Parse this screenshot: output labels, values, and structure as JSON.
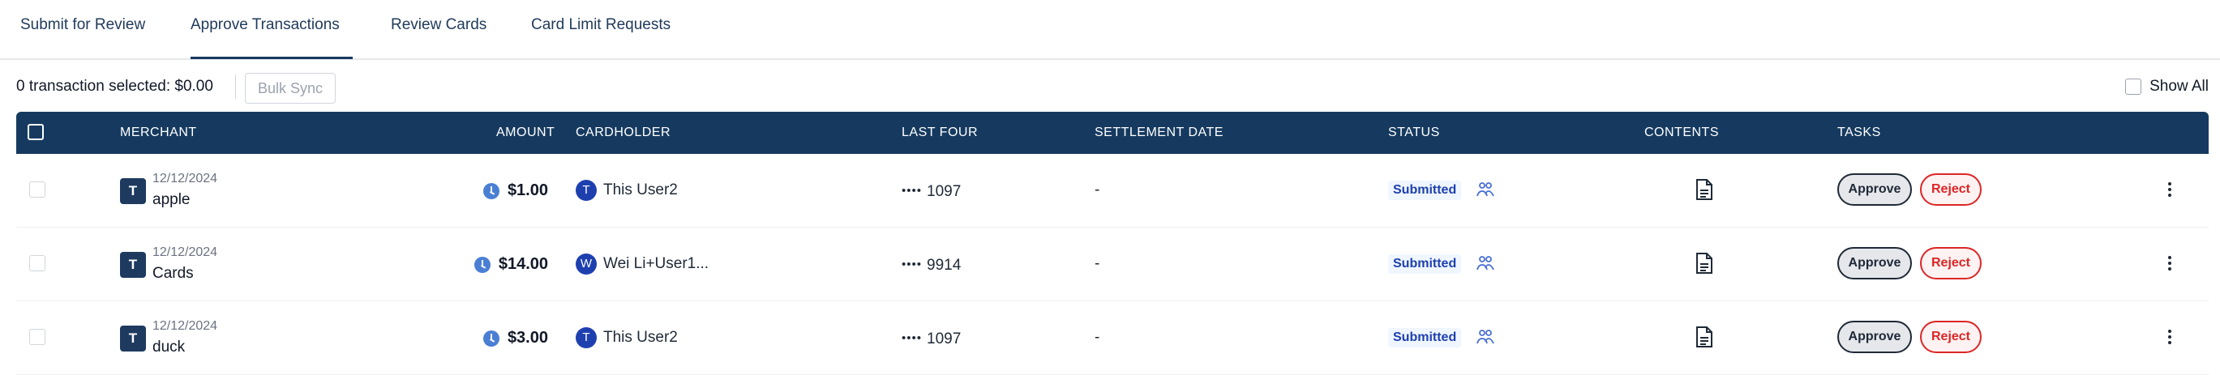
{
  "tabs": [
    {
      "label": "Submit for Review"
    },
    {
      "label": "Approve Transactions"
    },
    {
      "label": "Review Cards"
    },
    {
      "label": "Card Limit Requests"
    }
  ],
  "active_tab": "Approve Transactions",
  "toolbar": {
    "selection_text": "0 transaction selected: $0.00",
    "bulk_sync_label": "Bulk Sync",
    "show_all_label": "Show All"
  },
  "table": {
    "columns": {
      "merchant": "MERCHANT",
      "amount": "AMOUNT",
      "cardholder": "CARDHOLDER",
      "last_four": "LAST FOUR",
      "settlement_date": "SETTLEMENT DATE",
      "status": "STATUS",
      "contents": "CONTENTS",
      "tasks": "TASKS"
    },
    "rows": [
      {
        "merchant_initial": "T",
        "date": "12/12/2024",
        "merchant": "apple",
        "amount": "$1.00",
        "cardholder_initial": "T",
        "cardholder": "This User2",
        "last_four_dots": "••••",
        "last_four": "1097",
        "settlement_date": "-",
        "status": "Submitted",
        "approve": "Approve",
        "reject": "Reject"
      },
      {
        "merchant_initial": "T",
        "date": "12/12/2024",
        "merchant": "Cards",
        "amount": "$14.00",
        "cardholder_initial": "W",
        "cardholder": "Wei Li+User1...",
        "last_four_dots": "••••",
        "last_four": "9914",
        "settlement_date": "-",
        "status": "Submitted",
        "approve": "Approve",
        "reject": "Reject"
      },
      {
        "merchant_initial": "T",
        "date": "12/12/2024",
        "merchant": "duck",
        "amount": "$3.00",
        "cardholder_initial": "T",
        "cardholder": "This User2",
        "last_four_dots": "••••",
        "last_four": "1097",
        "settlement_date": "-",
        "status": "Submitted",
        "approve": "Approve",
        "reject": "Reject"
      }
    ]
  },
  "colors": {
    "header_bg": "#163a5f",
    "status_blue": "#1e40af",
    "reject_red": "#dc2626"
  }
}
